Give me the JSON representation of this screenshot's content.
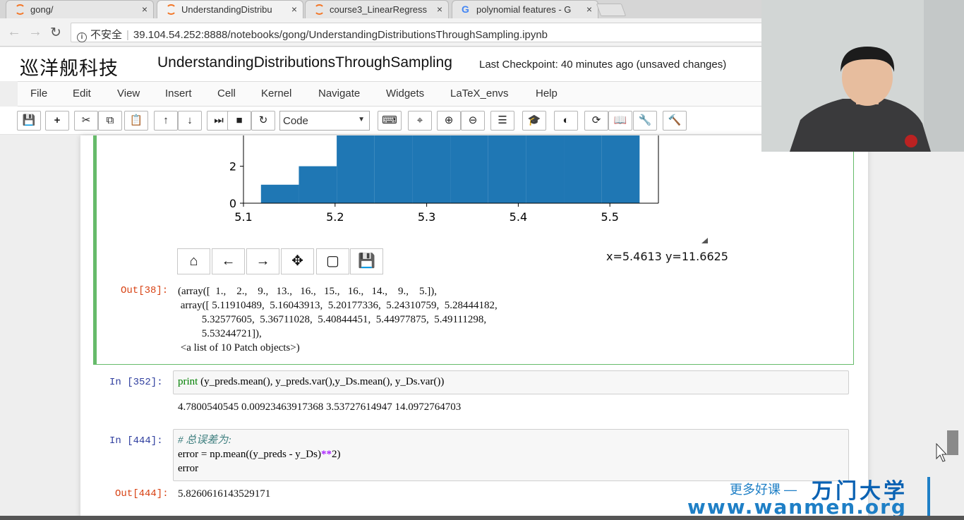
{
  "browser": {
    "tabs": [
      {
        "label": "gong/"
      },
      {
        "label": "UnderstandingDistribu"
      },
      {
        "label": "course3_LinearRegress"
      },
      {
        "label": "polynomial features - G"
      }
    ],
    "security_label": "不安全",
    "url": "39.104.54.252:8888/notebooks/gong/UnderstandingDistributionsThroughSampling.ipynb"
  },
  "header": {
    "logo_text": "巡洋舰科技",
    "notebook_title": "UnderstandingDistributionsThroughSampling",
    "checkpoint": "Last Checkpoint: 40 minutes ago (unsaved changes)"
  },
  "menu": [
    "File",
    "Edit",
    "View",
    "Insert",
    "Cell",
    "Kernel",
    "Navigate",
    "Widgets",
    "LaTeX_envs",
    "Help"
  ],
  "toolbar": {
    "cell_type": "Code",
    "icons": [
      "save-icon",
      "plus-icon",
      "cut-icon",
      "copy-icon",
      "paste-icon",
      "arrow-up-icon",
      "arrow-down-icon",
      "run-icon",
      "stop-icon",
      "restart-icon",
      "keyboard-icon",
      "crosshair-icon",
      "zoom-in-icon",
      "zoom-out-icon",
      "list-icon",
      "graduation-icon",
      "toggle-icon",
      "refresh-icon",
      "book-icon",
      "wrench-icon",
      "hammer-icon"
    ]
  },
  "chart_data": {
    "type": "bar",
    "bin_edges": [
      5.11910489,
      5.16043913,
      5.20177336,
      5.24310759,
      5.28444182,
      5.32577605,
      5.36711028,
      5.40844451,
      5.44977875,
      5.49111298,
      5.53244721
    ],
    "values": [
      1,
      2,
      9,
      13,
      16,
      15,
      16,
      14,
      9,
      5
    ],
    "xticks": [
      "5.1",
      "5.2",
      "5.3",
      "5.4",
      "5.5"
    ],
    "yticks": [
      "0",
      "2"
    ],
    "xlim": [
      5.1,
      5.553
    ],
    "ylim": [
      0,
      3.8
    ],
    "color": "#1f77b4"
  },
  "mpl": {
    "buttons": [
      "home-icon",
      "back-icon",
      "forward-icon",
      "move-icon",
      "zoom-rect-icon",
      "save-icon"
    ],
    "coord": "x=5.4613 y=11.6625"
  },
  "cells": {
    "out38_prompt": "Out[38]:",
    "out38_text": "(array([  1.,    2.,    9.,   13.,   16.,   15.,   16.,   14.,    9.,    5.]),\n array([ 5.11910489,  5.16043913,  5.20177336,  5.24310759,  5.28444182,\n         5.32577605,  5.36711028,  5.40844451,  5.44977875,  5.49111298,\n         5.53244721]),\n <a list of 10 Patch objects>)",
    "in352_prompt": "In  [352]:",
    "in352_kw": "print",
    "in352_rest": " (y_preds.mean(), y_preds.var(),y_Ds.mean(), y_Ds.var())",
    "out352_text": "4.7800540545 0.00923463917368 3.53727614947 14.0972764703",
    "in444_prompt": "In  [444]:",
    "in444_comment": "# 总误差为:",
    "in444_line2a": "error = np.mean((y_preds - y_Ds)",
    "in444_op": "**",
    "in444_line2b": "2)",
    "in444_line3": "error",
    "out444_prompt": "Out[444]:",
    "out444_text": "5.8260616143529171"
  },
  "watermark": {
    "top_text": "更多好课 —",
    "brand": "万门大学",
    "url": "www.wanmen.org"
  }
}
